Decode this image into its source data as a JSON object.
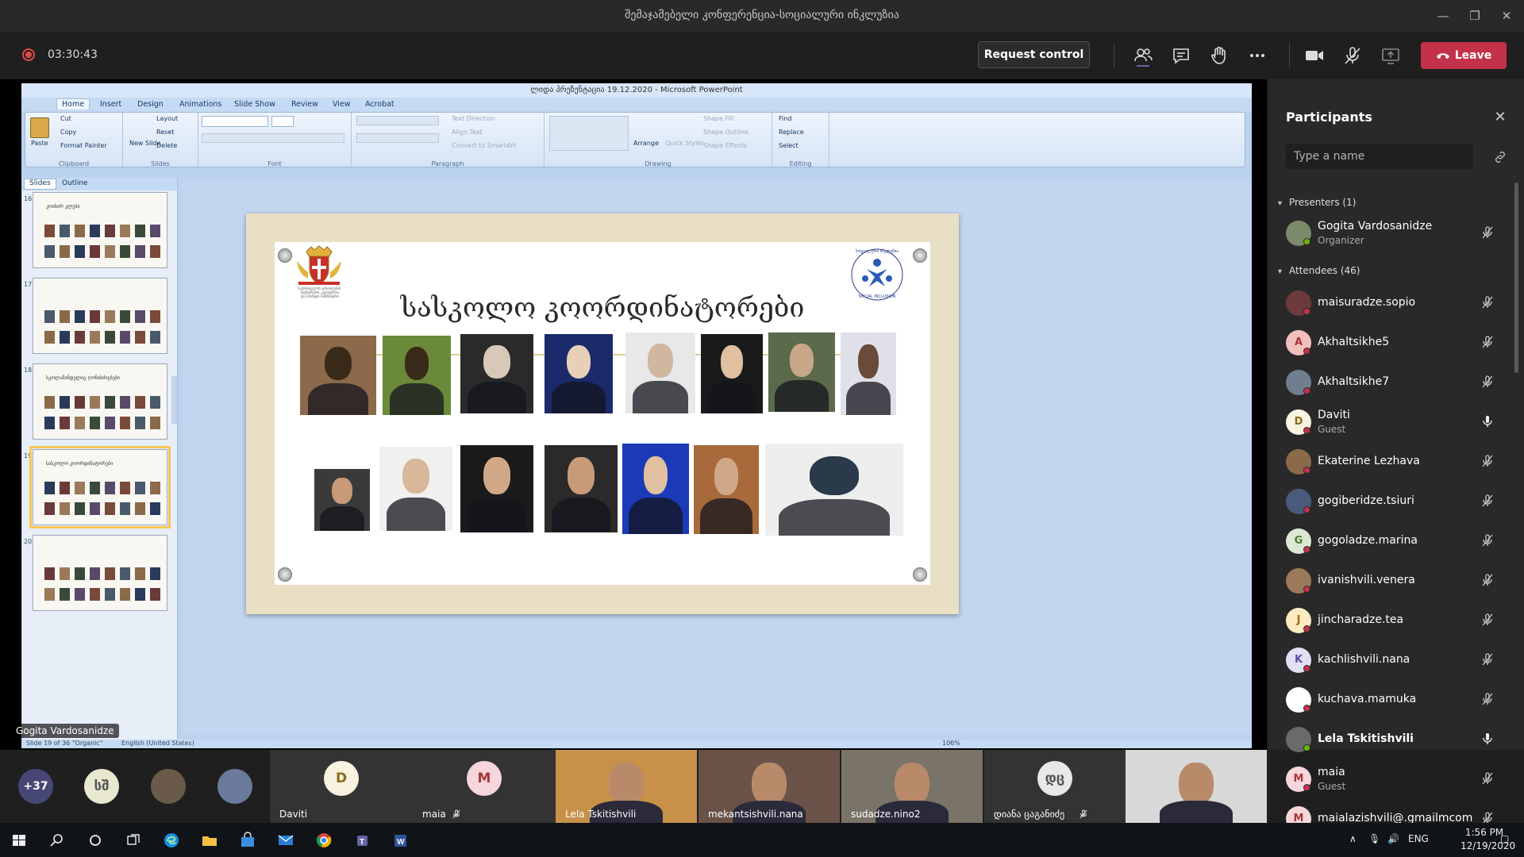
{
  "window": {
    "title": "შემაჯამებელი კონფერენცია-სოციალური ინკლუზია",
    "min": "—",
    "max": "❐",
    "close": "✕"
  },
  "call": {
    "timer": "03:30:43",
    "request_control": "Request control",
    "leave": "Leave",
    "toolbar_icons": [
      "participants-icon",
      "chat-icon",
      "raise-hand-icon",
      "more-icon",
      "camera-icon",
      "mic-off-icon",
      "share-tray-icon"
    ]
  },
  "ppt": {
    "title": "ლიდა პრეზენტაცია 19.12.2020 - Microsoft PowerPoint",
    "tabs": [
      "Home",
      "Insert",
      "Design",
      "Animations",
      "Slide Show",
      "Review",
      "View",
      "Acrobat"
    ],
    "active_tab": "Home",
    "clipboard": {
      "paste": "Paste",
      "cut": "Cut",
      "copy": "Copy",
      "format_painter": "Format Painter",
      "label": "Clipboard"
    },
    "slides_group": {
      "new_slide": "New Slide",
      "layout": "Layout",
      "reset": "Reset",
      "delete": "Delete",
      "label": "Slides"
    },
    "font_label": "Font",
    "paragraph": {
      "text_direction": "Text Direction",
      "align_text": "Align Text",
      "convert": "Convert to SmartArt",
      "label": "Paragraph"
    },
    "drawing": {
      "arrange": "Arrange",
      "quick_styles": "Quick Styles",
      "shape_fill": "Shape Fill",
      "shape_outline": "Shape Outline",
      "shape_effects": "Shape Effects",
      "label": "Drawing"
    },
    "editing": {
      "find": "Find",
      "replace": "Replace",
      "select": "Select",
      "label": "Editing"
    },
    "panel_tabs": [
      "Slides",
      "Outline"
    ],
    "thumbs": [
      {
        "num": "16",
        "title": "კოისირ კლუბი"
      },
      {
        "num": "17",
        "title": ""
      },
      {
        "num": "18",
        "title": "სკოლამანდელიგ ღონისძიებები"
      },
      {
        "num": "19",
        "title": "სასკოლო კოორდინატორები"
      },
      {
        "num": "20",
        "title": ""
      }
    ],
    "selected_thumb": 3,
    "status": {
      "slide": "Slide 19 of 36",
      "theme": "\"Organic\"",
      "lang": "English (United States)",
      "zoom": "106%"
    }
  },
  "slide": {
    "title": "სასკოლო კოორდინატორები",
    "crest_caption": [
      "საქართველოს განათლების,",
      "მეცნიერების, კულტურისა",
      "და სპორტის სამინისტრო"
    ],
    "logo_top": "სოციალური ინკლუზია",
    "logo_bottom": "SOCIAL INCLUSION"
  },
  "presenter_tag": "Gogita Vardosanidze",
  "participants": {
    "title": "Participants",
    "search_placeholder": "Type a name",
    "presenters_label": "Presenters (1)",
    "attendees_label": "Attendees (46)",
    "presenters": [
      {
        "name": "Gogita Vardosanidze",
        "role": "Organizer",
        "initial": "",
        "bg": "#7a8a6a",
        "muted": true,
        "status": "green"
      }
    ],
    "attendees": [
      {
        "name": "maisuradze.sopio",
        "role": "",
        "initial": "",
        "bg": "#6c3a3a",
        "muted": true,
        "status": "red"
      },
      {
        "name": "Akhaltsikhe5",
        "role": "",
        "initial": "A",
        "bg": "#f1c0bd",
        "fg": "#a4373a",
        "muted": true,
        "status": "red"
      },
      {
        "name": "Akhaltsikhe7",
        "role": "",
        "initial": "",
        "bg": "#6f7f8f",
        "muted": true,
        "status": "red"
      },
      {
        "name": "Daviti",
        "role": "Guest",
        "initial": "D",
        "bg": "#f8f3e1",
        "fg": "#8a6d1a",
        "muted": false,
        "status": "red"
      },
      {
        "name": "Ekaterine Lezhava",
        "role": "",
        "initial": "",
        "bg": "#8b6a4a",
        "muted": true,
        "status": "red"
      },
      {
        "name": "gogiberidze.tsiuri",
        "role": "",
        "initial": "",
        "bg": "#4a5a7a",
        "muted": true,
        "status": "red"
      },
      {
        "name": "gogoladze.marina",
        "role": "",
        "initial": "G",
        "bg": "#dde8d4",
        "fg": "#4d7a35",
        "muted": true,
        "status": "red"
      },
      {
        "name": "ivanishvili.venera",
        "role": "",
        "initial": "",
        "bg": "#9a7a5a",
        "muted": true,
        "status": "red"
      },
      {
        "name": "jincharadze.tea",
        "role": "",
        "initial": "J",
        "bg": "#fbeac2",
        "fg": "#a06a10",
        "muted": true,
        "status": "red"
      },
      {
        "name": "kachlishvili.nana",
        "role": "",
        "initial": "K",
        "bg": "#e4e0f4",
        "fg": "#5b4fa1",
        "muted": true,
        "status": "red"
      },
      {
        "name": "kuchava.mamuka",
        "role": "",
        "initial": "",
        "bg": "#ffffff",
        "muted": true,
        "status": "red"
      },
      {
        "name": "Lela Tskitishvili",
        "role": "",
        "initial": "",
        "bg": "#6a6a6a",
        "muted": false,
        "status": "green",
        "bold": true
      },
      {
        "name": "maia",
        "role": "Guest",
        "initial": "M",
        "bg": "#f6d6da",
        "fg": "#a4373a",
        "muted": true,
        "status": "red"
      },
      {
        "name": "maialazishvili@.gmailmcom",
        "role": "",
        "initial": "M",
        "bg": "#f6d6da",
        "fg": "#a4373a",
        "muted": true,
        "status": "red"
      }
    ]
  },
  "strip": {
    "overflow": "+37",
    "avatars": [
      {
        "initial": "სშ",
        "bg": "#e8e8d0",
        "fg": "#555"
      },
      {
        "initial": "",
        "bg": "#6a5a4a"
      },
      {
        "initial": "",
        "bg": "#6a7a9a"
      }
    ],
    "tiles": [
      {
        "name": "Daviti",
        "initial": "D",
        "bg": "#f8f3e1",
        "fg": "#8a6d1a",
        "muted": false
      },
      {
        "name": "maia",
        "initial": "M",
        "bg": "#f6d6da",
        "fg": "#a4373a",
        "muted": true
      },
      {
        "name": "Lela Tskitishvili",
        "video": true,
        "muted": false
      },
      {
        "name": "mekantsishvili.nana",
        "video": true,
        "muted": false
      },
      {
        "name": "sudadze.nino2",
        "video": true,
        "muted": false
      },
      {
        "name": "დიანა ცაგანიძე",
        "initial": "დც",
        "bg": "#e8e8e8",
        "fg": "#555",
        "muted": true
      },
      {
        "name": "",
        "video": true,
        "muted": false
      }
    ]
  },
  "taskbar": {
    "lang": "ENG",
    "time": "1:56 PM",
    "date": "12/19/2020",
    "apps": [
      "windows-start-icon",
      "search-icon",
      "cortana-icon",
      "task-view-icon",
      "edge-icon",
      "file-explorer-icon",
      "store-icon",
      "mail-icon",
      "chrome-icon",
      "teams-icon",
      "word-icon"
    ]
  },
  "colors": {
    "leave": "#c4314b",
    "accent": "#6264a7",
    "ribbon_blue": "#c5daf3",
    "muted_red": "#c4314b",
    "online_green": "#6bb700"
  }
}
